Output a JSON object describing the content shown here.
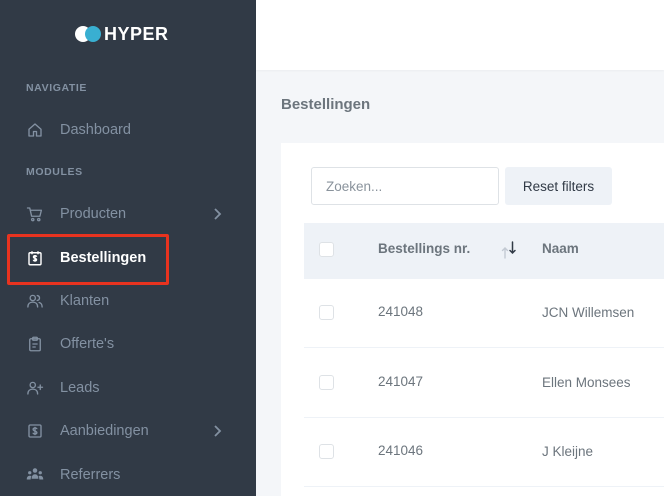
{
  "brand": {
    "name": "HYPER"
  },
  "sidebar": {
    "sections": [
      {
        "title": "NAVIGATIE"
      },
      {
        "title": "MODULES"
      }
    ],
    "items": [
      {
        "label": "Dashboard",
        "icon": "home-icon"
      },
      {
        "label": "Producten",
        "icon": "cart-icon",
        "has_submenu": true
      },
      {
        "label": "Bestellingen",
        "icon": "order-icon",
        "active": true
      },
      {
        "label": "Klanten",
        "icon": "users-icon"
      },
      {
        "label": "Offerte's",
        "icon": "clipboard-icon"
      },
      {
        "label": "Leads",
        "icon": "user-plus-icon"
      },
      {
        "label": "Aanbiedingen",
        "icon": "dollar-box-icon",
        "has_submenu": true
      },
      {
        "label": "Referrers",
        "icon": "group-icon"
      }
    ]
  },
  "page": {
    "title": "Bestellingen"
  },
  "filters": {
    "search_placeholder": "Zoeken...",
    "reset_label": "Reset filters"
  },
  "table": {
    "columns": [
      "Bestellings nr.",
      "Naam"
    ],
    "sort": {
      "column": "Bestellings nr.",
      "direction": "desc"
    },
    "rows": [
      {
        "order_no": "241048",
        "name": "JCN Willemsen"
      },
      {
        "order_no": "241047",
        "name": "Ellen Monsees"
      },
      {
        "order_no": "241046",
        "name": "J Kleijne"
      }
    ]
  },
  "colors": {
    "sidebar_bg": "#313a46",
    "sidebar_text": "#8391a2",
    "accent": "#39afd1",
    "highlight": "#e8331f",
    "table_head_bg": "#eef2f7"
  }
}
